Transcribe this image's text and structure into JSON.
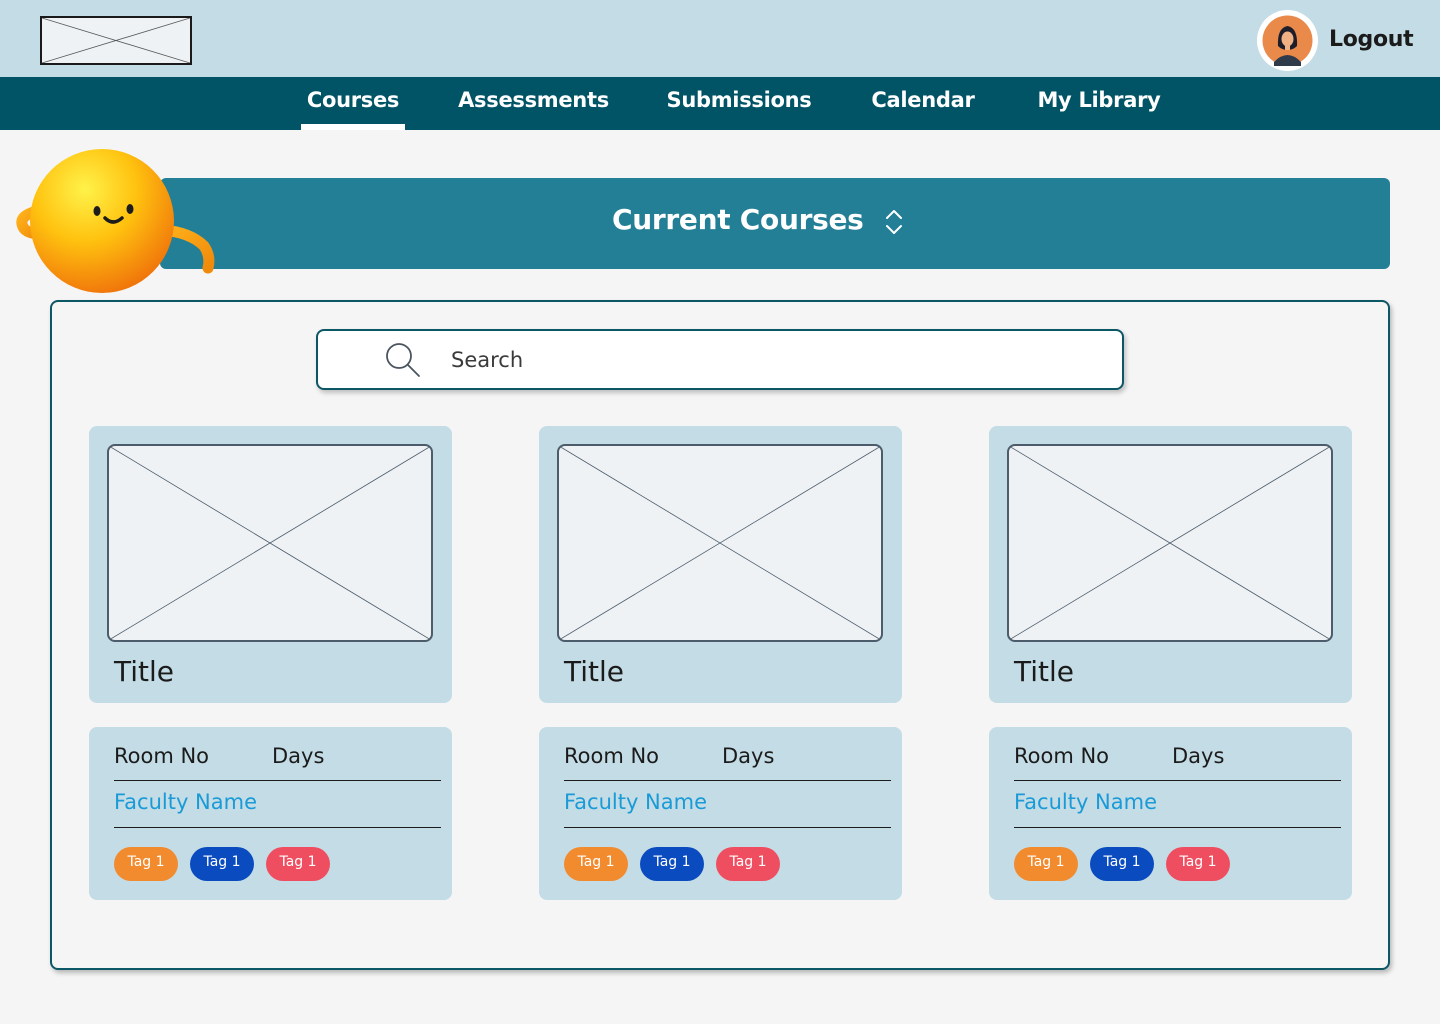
{
  "header": {
    "logo_icon": "image-placeholder-icon",
    "avatar_icon": "user-avatar-icon",
    "logout_label": "Logout"
  },
  "nav": {
    "items": [
      {
        "label": "Courses",
        "active": true
      },
      {
        "label": "Assessments",
        "active": false
      },
      {
        "label": "Submissions",
        "active": false
      },
      {
        "label": "Calendar",
        "active": false
      },
      {
        "label": "My Library",
        "active": false
      }
    ]
  },
  "banner": {
    "title": "Current Courses",
    "sort_icon": "chevron-up-down-icon",
    "mascot_icon": "smiley-ball-mascot"
  },
  "search": {
    "placeholder": "Search",
    "value": "",
    "icon": "search-icon"
  },
  "courses": [
    {
      "title": "Title",
      "room_label": "Room No",
      "days_label": "Days",
      "faculty": "Faculty Name",
      "tags": [
        "Tag 1",
        "Tag 1",
        "Tag 1"
      ]
    },
    {
      "title": "Title",
      "room_label": "Room No",
      "days_label": "Days",
      "faculty": "Faculty Name",
      "tags": [
        "Tag 1",
        "Tag 1",
        "Tag 1"
      ]
    },
    {
      "title": "Title",
      "room_label": "Room No",
      "days_label": "Days",
      "faculty": "Faculty Name",
      "tags": [
        "Tag 1",
        "Tag 1",
        "Tag 1"
      ]
    }
  ],
  "colors": {
    "topbar": "#c3dce5",
    "navbar": "#005466",
    "banner": "#237f96",
    "card": "#c3dce5",
    "faculty_link": "#1a9ad6",
    "tag_colors": [
      "#f28a2e",
      "#0a4bbf",
      "#ef4e60"
    ]
  }
}
